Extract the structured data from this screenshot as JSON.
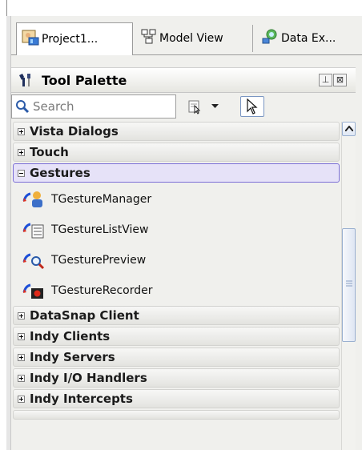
{
  "tabs": [
    {
      "label": "Project1...",
      "icon": "project-icon",
      "active": true
    },
    {
      "label": "Model View",
      "icon": "model-view-icon"
    },
    {
      "label": "Data Ex...",
      "icon": "data-explorer-icon"
    }
  ],
  "palette": {
    "title": "Tool Palette",
    "pin_glyph": "⊥",
    "close_glyph": "⊠"
  },
  "search": {
    "placeholder": "Search"
  },
  "categories": {
    "vista_dialogs": "Vista Dialogs",
    "touch": "Touch",
    "gestures": "Gestures",
    "datasnap_client": "DataSnap Client",
    "indy_clients": "Indy Clients",
    "indy_servers": "Indy Servers",
    "indy_io_handlers": "Indy I/O Handlers",
    "indy_intercepts": "Indy Intercepts"
  },
  "gesture_items": [
    {
      "label": "TGestureManager",
      "icon": "gesture-manager-icon"
    },
    {
      "label": "TGestureListView",
      "icon": "gesture-listview-icon"
    },
    {
      "label": "TGesturePreview",
      "icon": "gesture-preview-icon"
    },
    {
      "label": "TGestureRecorder",
      "icon": "gesture-recorder-icon"
    }
  ],
  "colors": {
    "selected_category": "#e6e2f8",
    "selected_border": "#7b6ed6",
    "scroll_accent": "#9ab0d0"
  }
}
